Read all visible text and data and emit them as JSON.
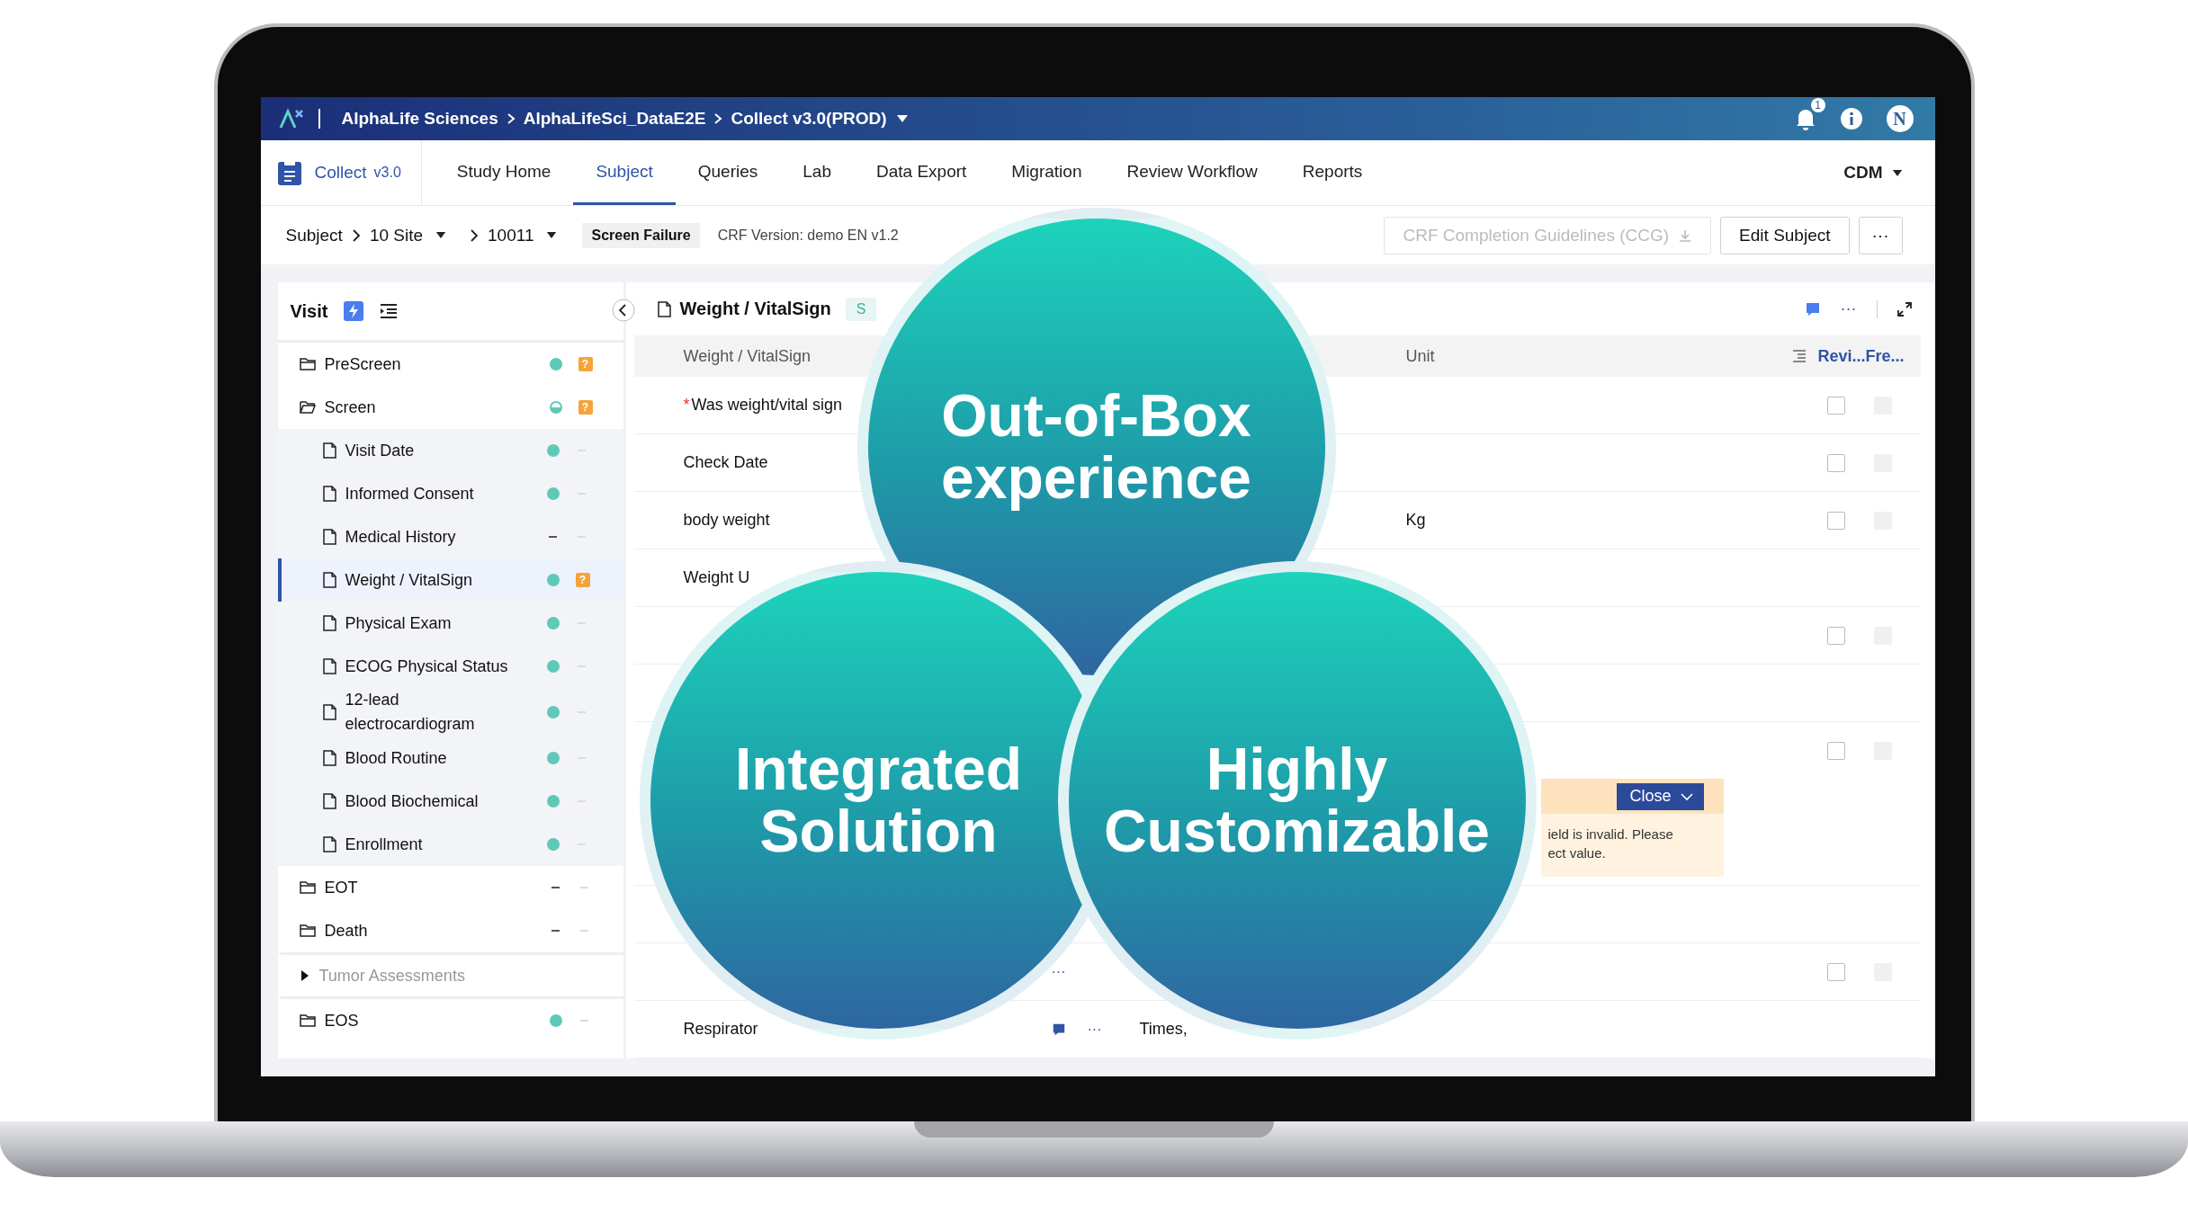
{
  "topbar": {
    "org": "AlphaLife Sciences",
    "study": "AlphaLifeSci_DataE2E",
    "env": "Collect v3.0(PROD)",
    "notifications": "1",
    "avatar": "N"
  },
  "nav": {
    "app": "Collect",
    "version": "v3.0",
    "role": "CDM",
    "tabs": [
      {
        "label": "Study Home",
        "selected": false
      },
      {
        "label": "Subject",
        "selected": true
      },
      {
        "label": "Queries",
        "selected": false
      },
      {
        "label": "Lab",
        "selected": false
      },
      {
        "label": "Data Export",
        "selected": false
      },
      {
        "label": "Migration",
        "selected": false
      },
      {
        "label": "Review Workflow",
        "selected": false
      },
      {
        "label": "Reports",
        "selected": false
      }
    ]
  },
  "subheader": {
    "crumbs": [
      {
        "label": "Subject",
        "dropdown": false
      },
      {
        "label": "10 Site",
        "dropdown": true
      },
      {
        "label": "10011",
        "dropdown": true
      }
    ],
    "status_tag": "Screen Failure",
    "crf_version": "CRF Version: demo EN v1.2",
    "more": "···",
    "buttons": [
      {
        "label": "CRF Completion Guidelines (CCG)",
        "kind": "download",
        "disabled": true
      },
      {
        "label": "Edit Subject",
        "kind": "plain",
        "disabled": false
      }
    ]
  },
  "sidebar": {
    "title": "Visit",
    "items": [
      {
        "label": "PreScreen",
        "kind": "folder",
        "expanded": false,
        "complete": true,
        "partial": false,
        "query": "?",
        "selected": false
      },
      {
        "label": "Screen",
        "kind": "folder",
        "expanded": true,
        "complete": false,
        "partial": true,
        "query": "?",
        "selected": false,
        "children": [
          {
            "label": "Visit Date",
            "complete": true,
            "partial": false,
            "selected": false
          },
          {
            "label": "Informed Consent",
            "complete": true,
            "partial": false,
            "selected": false
          },
          {
            "label": "Medical History",
            "complete": false,
            "partial": false,
            "selected": false
          },
          {
            "label": "Weight / VitalSign",
            "complete": true,
            "partial": false,
            "query": "?",
            "selected": true
          },
          {
            "label": "Physical Exam",
            "complete": true,
            "partial": false,
            "selected": false
          },
          {
            "label": "ECOG Physical Status",
            "complete": true,
            "partial": false,
            "selected": false
          },
          {
            "label": "12-lead electrocardiogram",
            "complete": true,
            "partial": false,
            "selected": false
          },
          {
            "label": "Blood Routine",
            "complete": true,
            "partial": false,
            "selected": false
          },
          {
            "label": "Blood Biochemical",
            "complete": true,
            "partial": false,
            "selected": false
          },
          {
            "label": "Enrollment",
            "complete": true,
            "partial": false,
            "selected": false
          }
        ]
      },
      {
        "label": "EOT",
        "kind": "folder",
        "expanded": false,
        "complete": false,
        "partial": false,
        "selected": false
      },
      {
        "label": "Death",
        "kind": "folder",
        "expanded": false,
        "complete": false,
        "partial": false,
        "selected": false
      },
      {
        "label": "Tumor Assessments",
        "kind": "group",
        "expanded": false,
        "selected": false
      },
      {
        "label": "EOS",
        "kind": "folder",
        "expanded": false,
        "complete": true,
        "partial": false,
        "selected": false
      }
    ]
  },
  "panel": {
    "title": "Weight / VitalSign",
    "status_tag": "S",
    "more": "···",
    "header": {
      "column_1": "Weight / VitalSign",
      "column_3": "Unit",
      "column_4": "Revi...",
      "column_5": "Fre..."
    },
    "rows": [
      {
        "label": "Was weight/vital sign",
        "required_mark": "*",
        "chat": false,
        "review_box": {
          "checked": false
        },
        "freeze_box": {
          "disabled": true
        }
      },
      {
        "label": "Check Date",
        "chat": false,
        "review_box": {
          "checked": false
        },
        "freeze_box": {
          "disabled": true
        }
      },
      {
        "label": "body weight",
        "chat": false,
        "unit": "Kg",
        "review_box": {
          "checked": false
        },
        "freeze_box": {
          "disabled": true
        }
      },
      {
        "label": "Weight U",
        "chat": false
      },
      {
        "review_box": {
          "checked": false
        },
        "freeze_box": {
          "disabled": true
        }
      },
      {},
      {
        "review_box": {
          "checked": false
        },
        "freeze_box": {
          "disabled": true
        },
        "query": {
          "action": "Close",
          "lines": [
            "ield is invalid. Please",
            "ect value."
          ]
        }
      },
      {},
      {
        "more": "···",
        "review_box": {
          "checked": false
        },
        "freeze_box": {
          "disabled": true
        }
      },
      {
        "label": "Respirator",
        "chat": true,
        "more": "···",
        "value": "Times,"
      }
    ]
  },
  "bubbles": [
    {
      "text": "Out-of-Box experience",
      "kind": "top"
    },
    {
      "text": "Integrated Solution",
      "kind": "left"
    },
    {
      "text": "Highly Customizable",
      "kind": "right"
    }
  ]
}
